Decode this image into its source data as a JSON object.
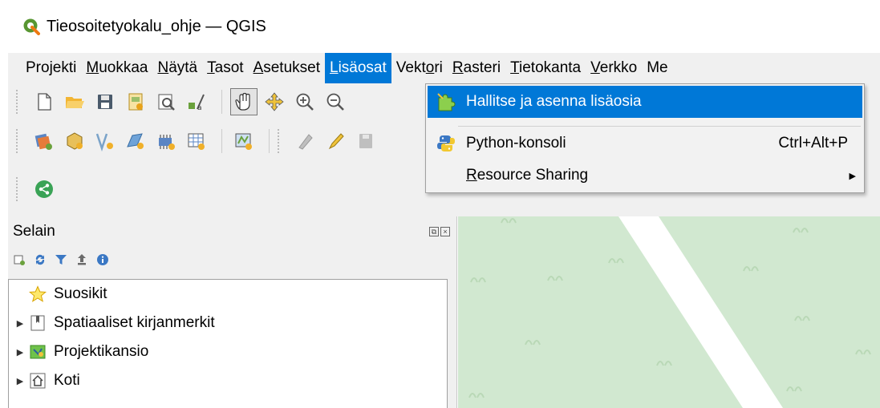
{
  "window": {
    "title": "Tieosoitetyokalu_ohje — QGIS"
  },
  "menubar": {
    "items": [
      {
        "pre": "Projekti",
        "mn": "",
        "post": ""
      },
      {
        "pre": "",
        "mn": "M",
        "post": "uokkaa"
      },
      {
        "pre": "",
        "mn": "N",
        "post": "äytä"
      },
      {
        "pre": "",
        "mn": "T",
        "post": "asot"
      },
      {
        "pre": "",
        "mn": "A",
        "post": "setukset"
      },
      {
        "pre": "",
        "mn": "L",
        "post": "isäosat"
      },
      {
        "pre": "Vekt",
        "mn": "o",
        "post": "ri"
      },
      {
        "pre": "",
        "mn": "R",
        "post": "asteri"
      },
      {
        "pre": "",
        "mn": "T",
        "post": "ietokanta"
      },
      {
        "pre": "",
        "mn": "V",
        "post": "erkko"
      },
      {
        "pre": "",
        "mn": "Me",
        "post": ""
      }
    ]
  },
  "plugins_menu": {
    "items": [
      {
        "label": "Hallitse ja asenna lisäosia",
        "shortcut": "",
        "icon": "puzzle-icon"
      },
      {
        "label": "Python-konsoli",
        "shortcut": "Ctrl+Alt+P",
        "icon": "python-icon"
      },
      {
        "pre": "",
        "mn": "R",
        "post": "esource Sharing",
        "icon": "",
        "submenu": true
      }
    ]
  },
  "browser": {
    "title": "Selain",
    "items": [
      {
        "label": "Suosikit",
        "icon": "star-icon",
        "expandable": false
      },
      {
        "label": "Spatiaaliset kirjanmerkit",
        "icon": "bookmark-icon",
        "expandable": true
      },
      {
        "label": "Projektikansio",
        "icon": "project-folder-icon",
        "expandable": true
      },
      {
        "label": "Koti",
        "icon": "home-icon",
        "expandable": true
      }
    ]
  },
  "colors": {
    "accent": "#0078d7",
    "map_bg": "#d1e8d0",
    "road": "#ffffff"
  }
}
